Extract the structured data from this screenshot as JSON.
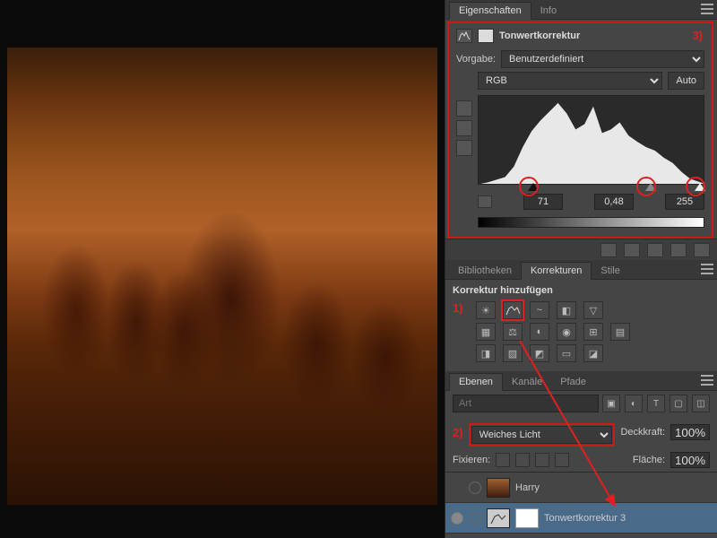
{
  "tabs_properties": {
    "active": "Eigenschaften",
    "other": "Info"
  },
  "properties": {
    "title": "Tonwertkorrektur",
    "annotation": "3)",
    "preset_label": "Vorgabe:",
    "preset_value": "Benutzerdefiniert",
    "channel_value": "RGB",
    "auto_label": "Auto",
    "shadow": "71",
    "mid": "0,48",
    "highlight": "255"
  },
  "tabs_adjust": {
    "a": "Bibliotheken",
    "b": "Korrekturen",
    "c": "Stile"
  },
  "adjustments": {
    "title": "Korrektur hinzufügen",
    "annotation": "1)",
    "icons_row1": [
      "brightness",
      "levels",
      "curves",
      "exposure",
      "vibrance"
    ],
    "icons_row2": [
      "hue-sat",
      "color-balance",
      "bw",
      "photo-filter",
      "channel-mixer",
      "lut"
    ],
    "icons_row3": [
      "invert",
      "posterize",
      "threshold",
      "gradient-map",
      "selective-color"
    ]
  },
  "tabs_layers": {
    "a": "Ebenen",
    "b": "Kanäle",
    "c": "Pfade"
  },
  "layers": {
    "search_placeholder": "Art",
    "blend_mode": "Weiches Licht",
    "annotation": "2)",
    "opacity_label": "Deckkraft:",
    "opacity_value": "100%",
    "lock_label": "Fixieren:",
    "fill_label": "Fläche:",
    "fill_value": "100%",
    "items": [
      {
        "name": "Harry",
        "active": false
      },
      {
        "name": "Tonwertkorrektur 3",
        "active": true
      }
    ]
  },
  "chart_data": {
    "type": "area",
    "title": "Tonwertkorrektur",
    "xlabel": "",
    "ylabel": "",
    "xlim": [
      0,
      255
    ],
    "ylim": [
      0,
      100
    ],
    "x": [
      0,
      10,
      20,
      30,
      40,
      50,
      60,
      70,
      80,
      90,
      100,
      110,
      120,
      130,
      140,
      150,
      160,
      170,
      180,
      190,
      200,
      210,
      220,
      230,
      240,
      255
    ],
    "values": [
      0,
      2,
      5,
      8,
      20,
      42,
      60,
      72,
      82,
      92,
      80,
      62,
      68,
      88,
      58,
      62,
      70,
      55,
      48,
      42,
      38,
      30,
      24,
      14,
      6,
      1
    ],
    "sliders": {
      "shadow": 71,
      "mid": 0.48,
      "highlight": 255
    }
  }
}
